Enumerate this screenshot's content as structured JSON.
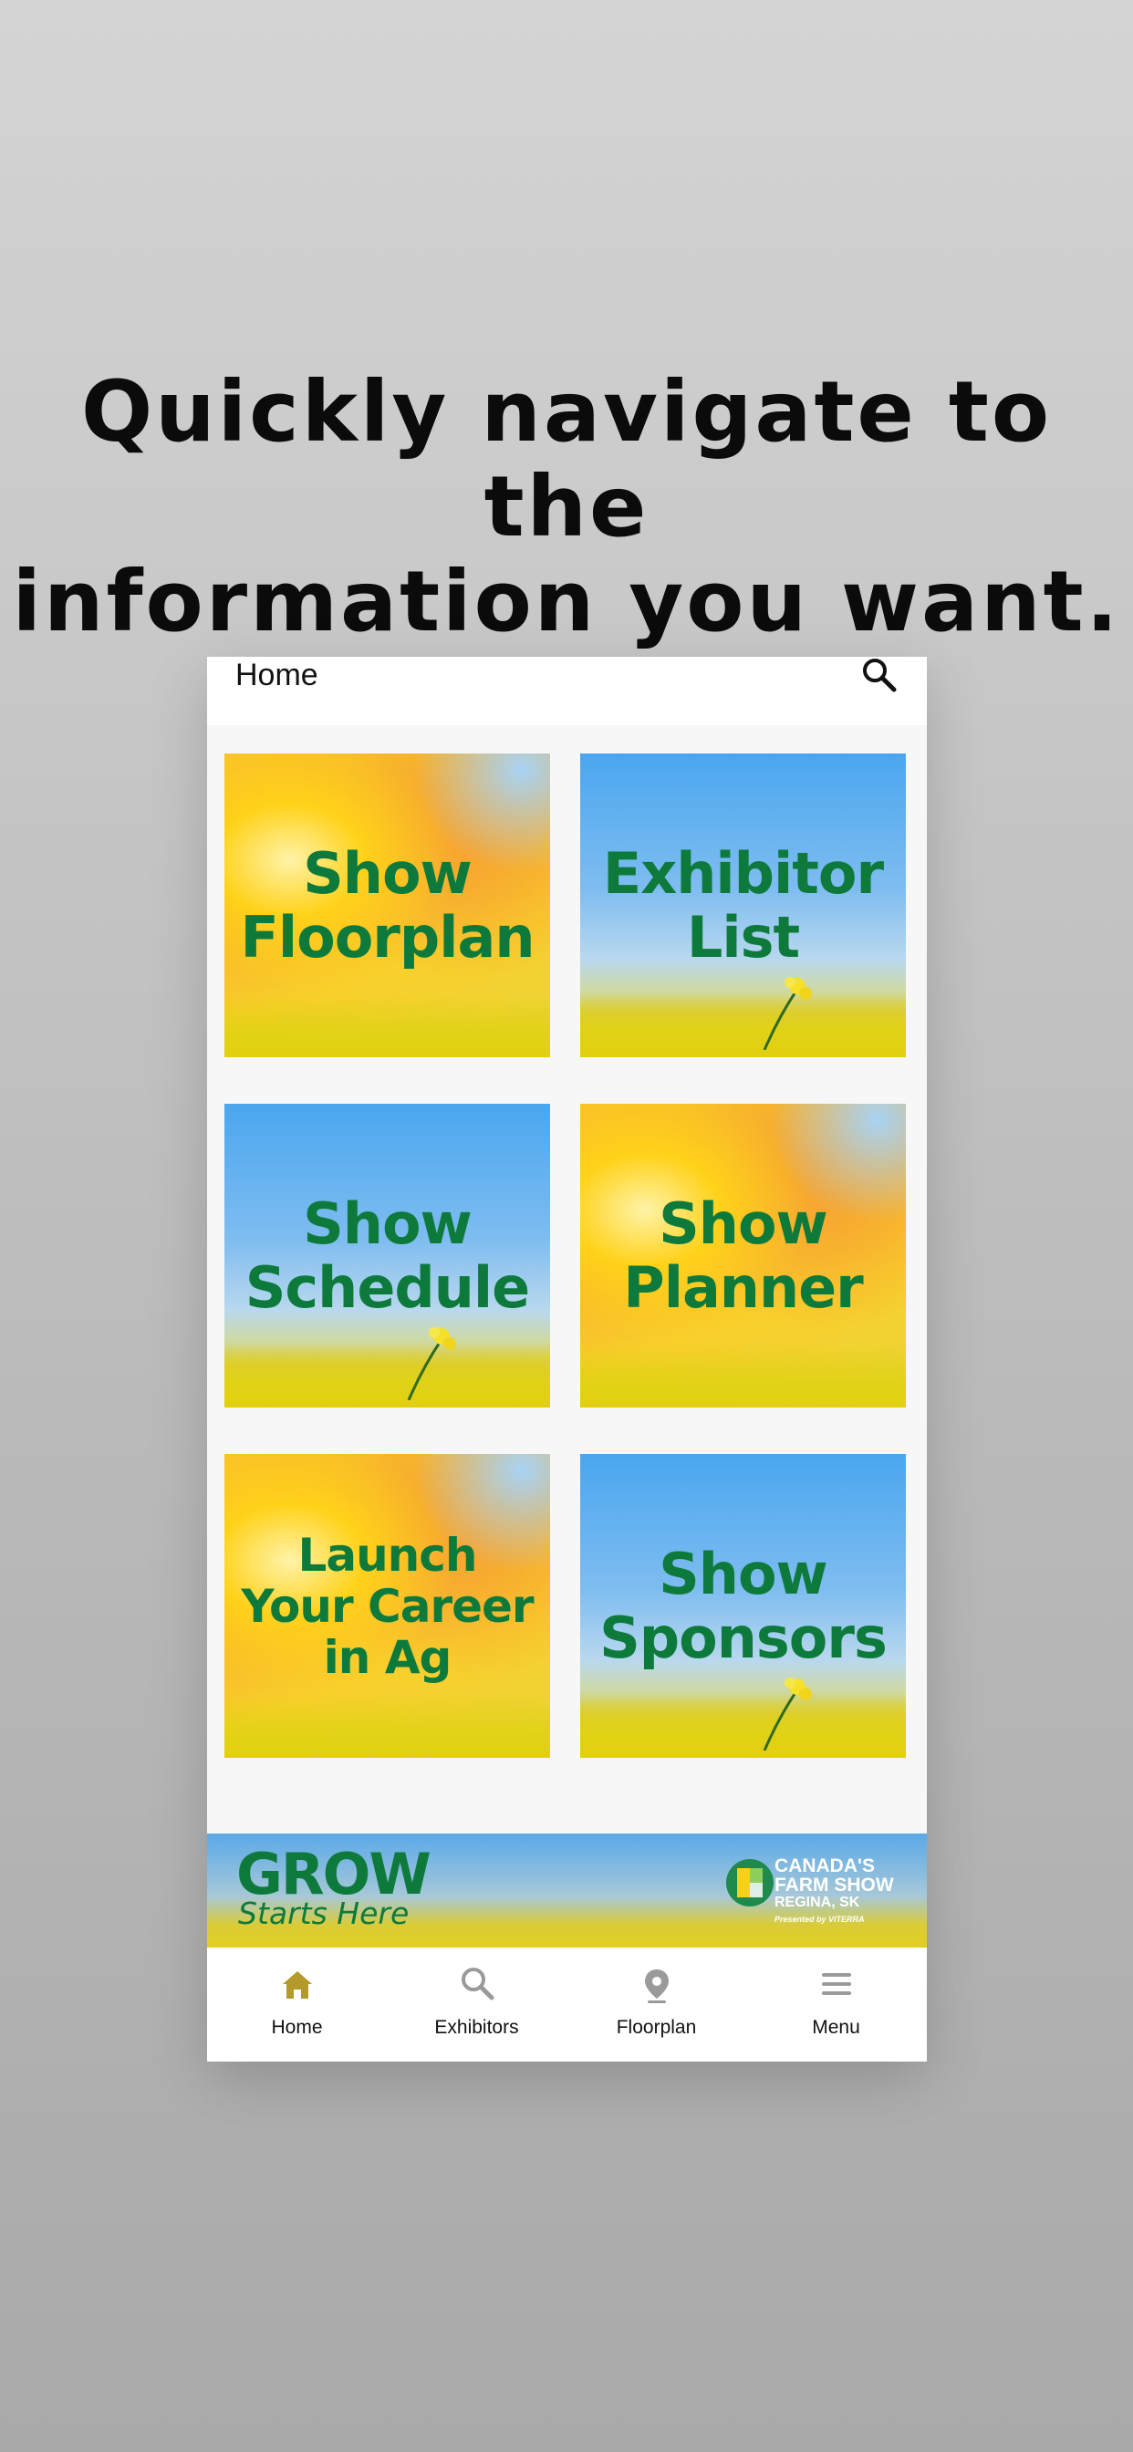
{
  "headline": {
    "line1": "Quickly navigate to the",
    "line2": "information you want."
  },
  "app": {
    "title": "Home",
    "accent_color": "#0d7a3c",
    "active_tab_color": "#b49a2a",
    "tiles": [
      {
        "label": "Show\nFloorplan",
        "style": "sun"
      },
      {
        "label": "Exhibitor\nList",
        "style": "sky"
      },
      {
        "label": "Show\nSchedule",
        "style": "sky"
      },
      {
        "label": "Show\nPlanner",
        "style": "sun"
      },
      {
        "label": "Launch\nYour Career\nin Ag",
        "style": "sun"
      },
      {
        "label": "Show\nSponsors",
        "style": "sky"
      }
    ],
    "banner": {
      "grow": "GROW",
      "tagline": "Starts Here",
      "brand_line1": "CANADA'S",
      "brand_line2": "FARM SHOW",
      "brand_line3": "REGINA, SK",
      "brand_line4": "Presented by VITERRA"
    },
    "tabs": [
      {
        "label": "Home",
        "icon": "home-icon",
        "active": true
      },
      {
        "label": "Exhibitors",
        "icon": "search-icon",
        "active": false
      },
      {
        "label": "Floorplan",
        "icon": "map-pin-icon",
        "active": false
      },
      {
        "label": "Menu",
        "icon": "menu-icon",
        "active": false
      }
    ]
  }
}
